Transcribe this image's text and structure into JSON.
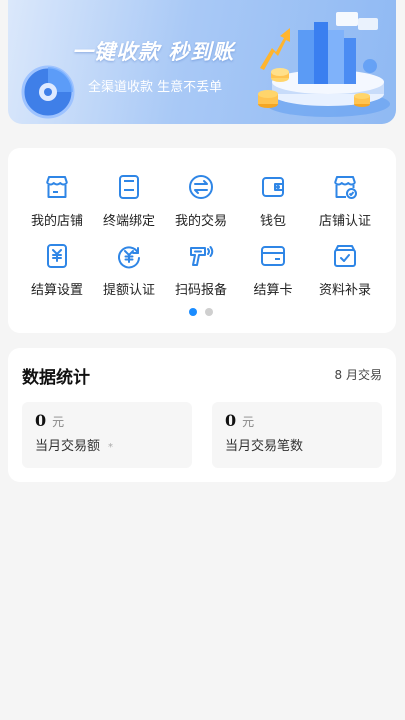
{
  "banner": {
    "title": "一键收款  秒到账",
    "subtitle": "全渠道收款 生意不丢单"
  },
  "menu": {
    "items": [
      {
        "label": "我的店铺",
        "icon": "store-icon"
      },
      {
        "label": "终端绑定",
        "icon": "pos-terminal-icon"
      },
      {
        "label": "我的交易",
        "icon": "exchange-icon"
      },
      {
        "label": "钱包",
        "icon": "wallet-icon"
      },
      {
        "label": "店铺认证",
        "icon": "store-verify-icon"
      },
      {
        "label": "结算设置",
        "icon": "settlement-icon"
      },
      {
        "label": "提额认证",
        "icon": "limit-raise-icon"
      },
      {
        "label": "扫码报备",
        "icon": "scanner-icon"
      },
      {
        "label": "结算卡",
        "icon": "bank-card-icon"
      },
      {
        "label": "资料补录",
        "icon": "document-box-icon"
      }
    ],
    "page_dots": {
      "active": 1,
      "total": 2
    }
  },
  "stats": {
    "title": "数据统计",
    "month_label": "8 月交易",
    "boxes": [
      {
        "value": "0",
        "unit": "元",
        "label": "当月交易额",
        "mark": "*"
      },
      {
        "value": "0",
        "unit": "元",
        "label": "当月交易笔数"
      }
    ]
  },
  "colors": {
    "accent": "#1a8cff",
    "icon": "#2f86e6",
    "banner_start": "#dbe8fb",
    "banner_end": "#8fb9f3"
  }
}
